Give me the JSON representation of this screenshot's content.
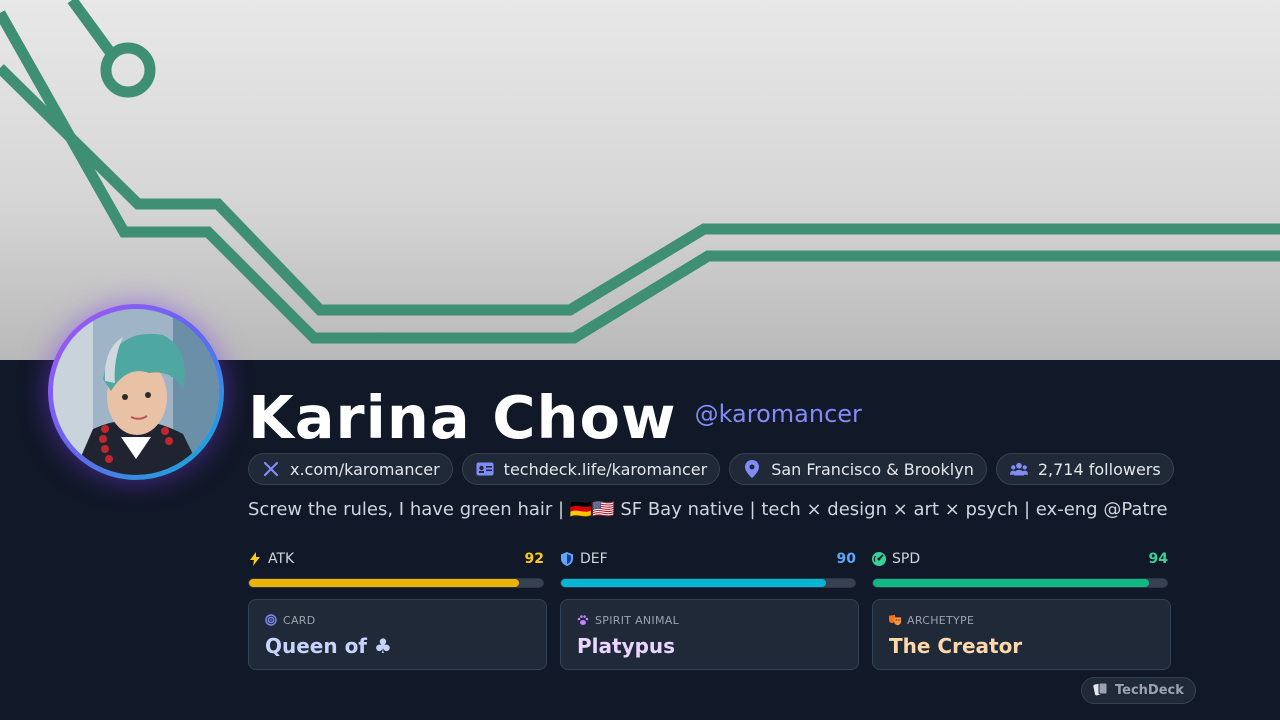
{
  "profile": {
    "name": "Karina Chow",
    "handle": "@karomancer",
    "bio": "Screw the rules, I have green hair | 🇩🇪🇺🇸 SF Bay native | tech × design × art × psych | ex-eng @Patreon,..."
  },
  "chips": [
    {
      "icon": "x-logo-icon",
      "label": "x.com/karomancer"
    },
    {
      "icon": "id-card-icon",
      "label": "techdeck.life/karomancer"
    },
    {
      "icon": "location-pin-icon",
      "label": "San Francisco & Brooklyn"
    },
    {
      "icon": "users-icon",
      "label": "2,714 followers"
    }
  ],
  "stats": [
    {
      "icon": "lightning-icon",
      "label": "ATK",
      "value": "92",
      "fraction": 0.92,
      "color": "#facc15",
      "bar_color": "#eab308"
    },
    {
      "icon": "shield-icon",
      "label": "DEF",
      "value": "90",
      "fraction": 0.9,
      "color": "#60a5fa",
      "bar_color": "#06b6d4"
    },
    {
      "icon": "speedometer-icon",
      "label": "SPD",
      "value": "94",
      "fraction": 0.94,
      "color": "#34d399",
      "bar_color": "#10b981"
    }
  ],
  "cards": [
    {
      "icon": "target-icon",
      "label": "CARD",
      "value": "Queen of ♣",
      "color": "#c7d2fe"
    },
    {
      "icon": "paw-icon",
      "label": "SPIRIT ANIMAL",
      "value": "Platypus",
      "color": "#e9d5ff"
    },
    {
      "icon": "theater-masks-icon",
      "label": "ARCHETYPE",
      "value": "The Creator",
      "color": "#fed7aa"
    }
  ],
  "brand": {
    "icon": "cards-icon",
    "label": "TechDeck"
  },
  "colors": {
    "accent": "#818cf8",
    "background": "#111827",
    "circuit": "#3f8f74"
  }
}
